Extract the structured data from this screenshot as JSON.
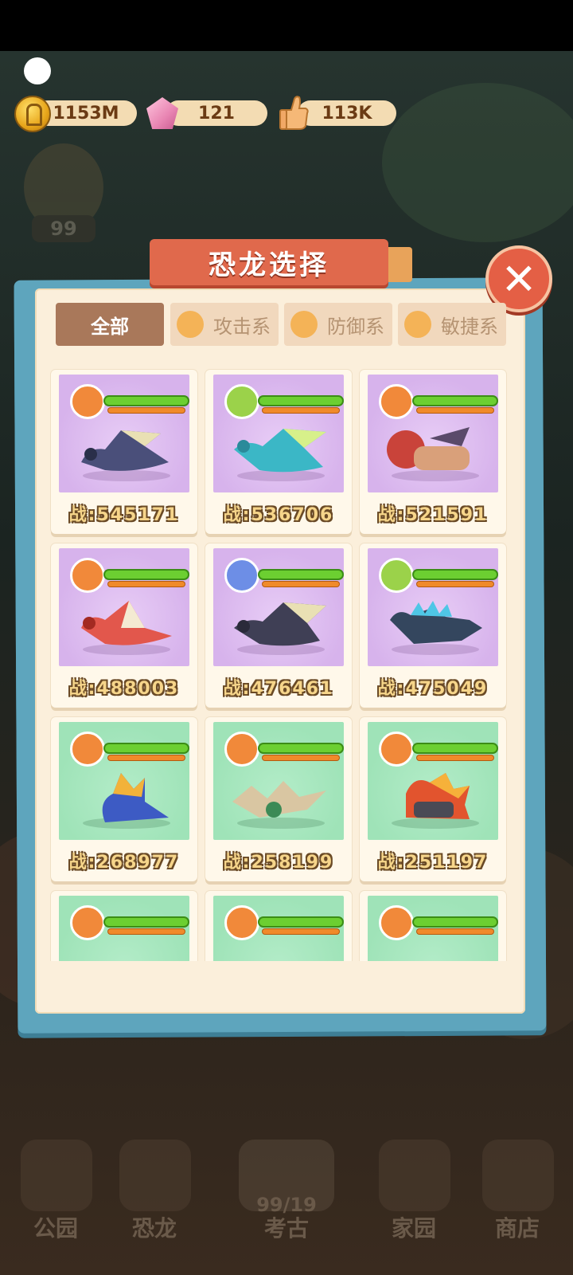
{
  "resources": {
    "gold": "1153M",
    "gems": "121",
    "likes": "113K"
  },
  "background": {
    "level": "99"
  },
  "dialog": {
    "title": "恐龙选择",
    "close_label": "✕"
  },
  "tabs": [
    {
      "label": "全部",
      "active": true
    },
    {
      "label": "攻击系",
      "active": false
    },
    {
      "label": "防御系",
      "active": false
    },
    {
      "label": "敏捷系",
      "active": false
    }
  ],
  "dinos": [
    {
      "power": "战:545171",
      "bg": "purple",
      "type": "attack"
    },
    {
      "power": "战:536706",
      "bg": "purple",
      "type": "agility"
    },
    {
      "power": "战:521591",
      "bg": "purple",
      "type": "attack"
    },
    {
      "power": "战:488003",
      "bg": "purple",
      "type": "attack"
    },
    {
      "power": "战:476461",
      "bg": "purple",
      "type": "defense"
    },
    {
      "power": "战:475049",
      "bg": "purple",
      "type": "agility"
    },
    {
      "power": "战:268977",
      "bg": "green",
      "type": "attack"
    },
    {
      "power": "战:258199",
      "bg": "green",
      "type": "attack"
    },
    {
      "power": "战:251197",
      "bg": "green",
      "type": "attack"
    },
    {
      "power": "",
      "bg": "green",
      "type": "attack"
    },
    {
      "power": "",
      "bg": "green",
      "type": "attack"
    },
    {
      "power": "",
      "bg": "green",
      "type": "attack"
    }
  ],
  "nav": {
    "items": [
      "公园",
      "恐龙",
      "考古",
      "家园",
      "商店"
    ],
    "energy": "99/19"
  },
  "colors": {
    "panel": "#fbefdb",
    "title_banner": "#e0694c",
    "active_tab": "#a9785a",
    "purple_card": "#d7b3ec",
    "green_card": "#9fe3b8"
  }
}
